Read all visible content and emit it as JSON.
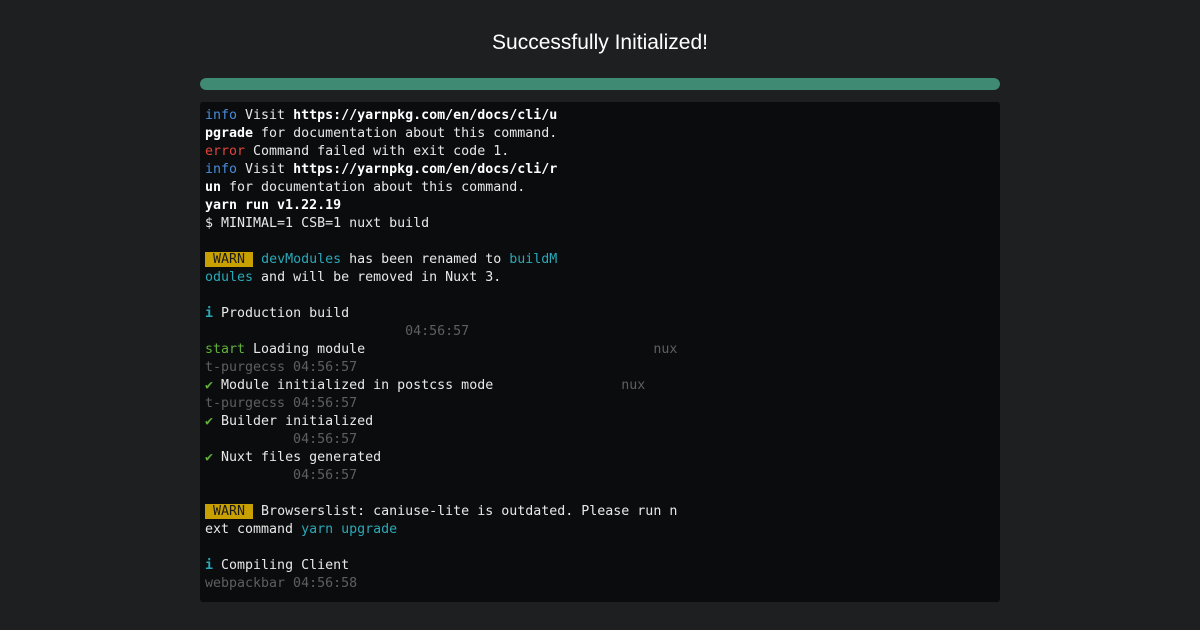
{
  "header": {
    "title": "Successfully Initialized!"
  },
  "progress": {
    "value_percent": 100,
    "color": "#3f8a72"
  },
  "colors": {
    "background": "#1d1f21",
    "terminal_bg": "#0b0c0d",
    "info": "#4a8cdb",
    "error": "#e0453b",
    "cyan": "#2aa8b8",
    "green": "#5fb13a",
    "warn_badge": "#c8a000",
    "dim": "#5c5f63"
  },
  "terminal": {
    "lines": [
      [
        {
          "t": "info",
          "c": "c-info"
        },
        {
          "t": " Visit "
        },
        {
          "t": "https://yarnpkg.com/en/docs/cli/u",
          "c": "c-bold"
        }
      ],
      [
        {
          "t": "pgrade",
          "c": "c-bold"
        },
        {
          "t": " for documentation about this command."
        }
      ],
      [
        {
          "t": "error",
          "c": "c-error"
        },
        {
          "t": " Command failed with exit code 1."
        }
      ],
      [
        {
          "t": "info",
          "c": "c-info"
        },
        {
          "t": " Visit "
        },
        {
          "t": "https://yarnpkg.com/en/docs/cli/r",
          "c": "c-bold"
        }
      ],
      [
        {
          "t": "un",
          "c": "c-bold"
        },
        {
          "t": " for documentation about this command."
        }
      ],
      [
        {
          "t": "yarn run v1.22.19",
          "c": "c-bold"
        }
      ],
      [
        {
          "t": "$ MINIMAL=1 CSB=1 nuxt build"
        }
      ],
      [],
      [
        {
          "t": " WARN ",
          "c": "badge-warn",
          "icon": "warn-badge"
        },
        {
          "t": " "
        },
        {
          "t": "devModules",
          "c": "c-cyan"
        },
        {
          "t": " has been renamed to "
        },
        {
          "t": "buildM",
          "c": "c-cyan"
        }
      ],
      [
        {
          "t": "odules",
          "c": "c-cyan"
        },
        {
          "t": " and will be removed in Nuxt 3."
        }
      ],
      [],
      [
        {
          "t": "i",
          "c": "c-info-icon",
          "icon": "info-icon"
        },
        {
          "t": " Production build"
        }
      ],
      [
        {
          "t": "                         04:56:57",
          "c": "c-dim"
        }
      ],
      [
        {
          "t": "start",
          "c": "c-green"
        },
        {
          "t": " Loading module                                    "
        },
        {
          "t": "nux",
          "c": "c-dim"
        }
      ],
      [
        {
          "t": "t-purgecss 04:56:57",
          "c": "c-dim"
        }
      ],
      [
        {
          "t": "✔",
          "c": "check-icon",
          "icon": "check-icon"
        },
        {
          "t": " Module initialized in postcss mode                "
        },
        {
          "t": "nux",
          "c": "c-dim"
        }
      ],
      [
        {
          "t": "t-purgecss 04:56:57",
          "c": "c-dim"
        }
      ],
      [
        {
          "t": "✔",
          "c": "check-icon",
          "icon": "check-icon"
        },
        {
          "t": " Builder initialized"
        }
      ],
      [
        {
          "t": "           04:56:57",
          "c": "c-dim"
        }
      ],
      [
        {
          "t": "✔",
          "c": "check-icon",
          "icon": "check-icon"
        },
        {
          "t": " Nuxt files generated"
        }
      ],
      [
        {
          "t": "           04:56:57",
          "c": "c-dim"
        }
      ],
      [],
      [
        {
          "t": " WARN ",
          "c": "badge-warn",
          "icon": "warn-badge"
        },
        {
          "t": " Browserslist: caniuse-lite is outdated. Please run n"
        }
      ],
      [
        {
          "t": "ext command "
        },
        {
          "t": "yarn upgrade",
          "c": "c-cyan"
        }
      ],
      [],
      [
        {
          "t": "i",
          "c": "c-info-icon",
          "icon": "info-icon"
        },
        {
          "t": " Compiling Client"
        }
      ],
      [
        {
          "t": "webpackbar 04:56:58",
          "c": "c-dim"
        }
      ]
    ]
  }
}
